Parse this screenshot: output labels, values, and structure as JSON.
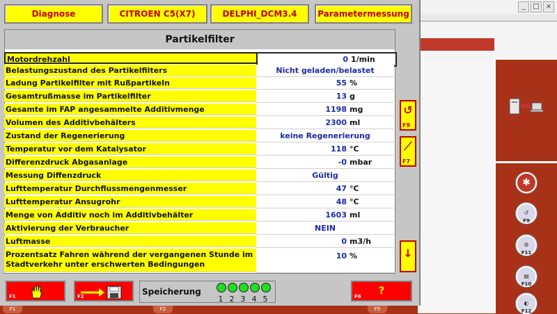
{
  "header": {
    "buttons": [
      "Diagnose",
      "CITROEN C5(X7)",
      "DELPHI_DCM3.4",
      "Parametermessung"
    ]
  },
  "panel": {
    "title": "Partikelfilter",
    "rows": [
      {
        "label": "Motordrehzahl",
        "value": "0",
        "unit": "1/min"
      },
      {
        "label": "Belastungszustand des Partikelfilters",
        "text": "Nicht geladen/belastet"
      },
      {
        "label": "Ladung Partikelfilter mit Rußpartikeln",
        "value": "55",
        "unit": "%"
      },
      {
        "label": "Gesamtrußmasse im Partikelfilter",
        "value": "13",
        "unit": "g"
      },
      {
        "label": "Gesamte im FAP angesammelte Additivmenge",
        "value": "1198",
        "unit": "mg"
      },
      {
        "label": "Volumen des Additivbehälters",
        "value": "2300",
        "unit": "ml"
      },
      {
        "label": "Zustand der Regenerierung",
        "text": "keine Regenerierung"
      },
      {
        "label": "Temperatur vor dem Katalysator",
        "value": "118",
        "unit": "°C"
      },
      {
        "label": "Differenzdruck Abgasanlage",
        "value": "-0",
        "unit": "mbar"
      },
      {
        "label": "Messung Diffenzdruck",
        "text": "Gültig"
      },
      {
        "label": "Lufttemperatur Durchflussmengenmesser",
        "value": "47",
        "unit": "°C"
      },
      {
        "label": "Lufttemperatur Ansugrohr",
        "value": "48",
        "unit": "°C"
      },
      {
        "label": "Menge von Additiv noch im Additivbehälter",
        "value": "1603",
        "unit": "ml"
      },
      {
        "label": "Aktivierung der Verbraucher",
        "text": "NEIN"
      },
      {
        "label": "Luftmasse",
        "value": "0",
        "unit": "m3/h"
      },
      {
        "label": "Prozentsatz Fahren während der vergangenen Stunde im Stadtverkehr unter erschwerten Bedingungen",
        "value": "10",
        "unit": "%"
      }
    ]
  },
  "side_buttons": {
    "f9": "F9",
    "f7": "F7"
  },
  "footer": {
    "f1": "F1",
    "f2": "F2",
    "f6": "F6",
    "help": "?",
    "save_label": "Speicherung",
    "slots": [
      "1",
      "2",
      "3",
      "4",
      "5"
    ]
  },
  "background": {
    "fkeys": [
      "F9",
      "F11",
      "F10",
      "F12"
    ],
    "tabs": [
      "F1",
      "F2",
      "F5"
    ]
  },
  "colors": {
    "yellow": "#ffff00",
    "red": "#ff0000",
    "value_blue": "#1a2aa8",
    "led_green": "#22dd22"
  }
}
